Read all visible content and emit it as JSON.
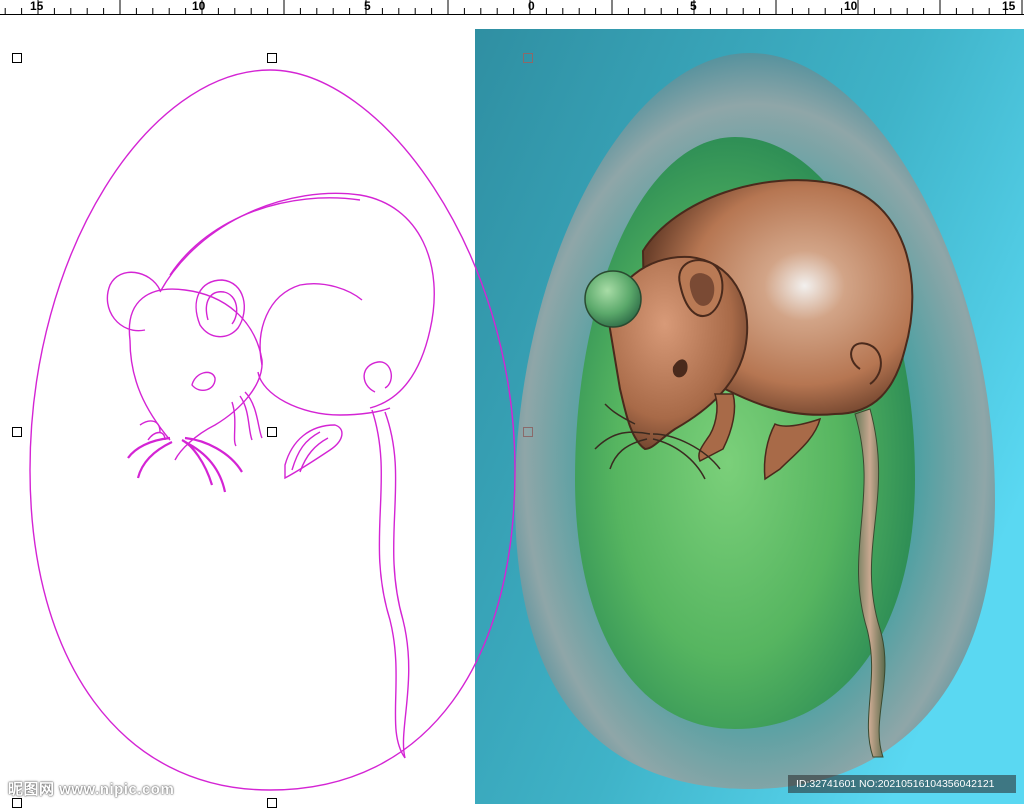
{
  "ruler": {
    "labels": [
      "15",
      "10",
      "5",
      "0",
      "5",
      "10",
      "15"
    ]
  },
  "colors": {
    "vector_stroke": "#d424d4",
    "relief_background": "#3fb6c8",
    "relief_body": "#c08060",
    "relief_inner": "#5fb86a"
  },
  "watermark": {
    "text": "昵图网 www.nipic.com"
  },
  "image_id": {
    "text": "ID:32741601 NO:20210516104356042121"
  }
}
